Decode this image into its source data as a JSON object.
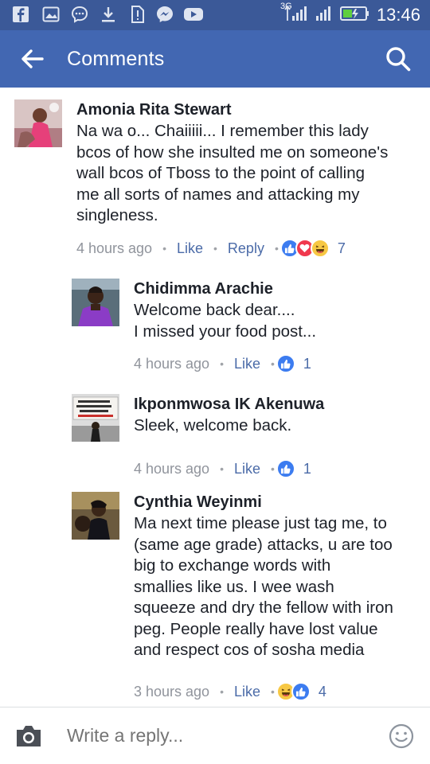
{
  "status_bar": {
    "network": "3G",
    "time": "13:46",
    "icons": [
      "facebook-icon",
      "gallery-icon",
      "chat-icon",
      "download-icon",
      "alert-icon",
      "messenger-icon",
      "youtube-icon",
      "signal-icon",
      "battery-icon"
    ]
  },
  "app_bar": {
    "title": "Comments",
    "back_icon": "arrow-left-icon",
    "search_icon": "search-icon"
  },
  "colors": {
    "status_bar": "#3b5998",
    "app_bar": "#4267b2",
    "link": "#4b6ba8",
    "like_blue": "#3c7cf0",
    "love_red": "#f0394e",
    "haha_yellow": "#f7c844"
  },
  "comments": [
    {
      "author": "Amonia Rita Stewart",
      "lines": [
        "Na wa o... Chaiiiii... I remember this lady",
        "bcos of how she insulted me on someone's",
        "wall bcos of Tboss to the point of calling",
        "me all sorts of names and attacking my",
        "singleness."
      ],
      "time": "4 hours ago",
      "like_label": "Like",
      "reply_label": "Reply",
      "reactions": [
        "like",
        "love",
        "haha"
      ],
      "reaction_count": "7"
    },
    {
      "author": "Chidimma Arachie",
      "lines": [
        "Welcome back dear....",
        "I missed your food post..."
      ],
      "time": "4 hours ago",
      "like_label": "Like",
      "reactions": [
        "like"
      ],
      "reaction_count": "1"
    },
    {
      "author": "Ikponmwosa IK Akenuwa",
      "lines": [
        "Sleek, welcome back."
      ],
      "time": "4 hours ago",
      "like_label": "Like",
      "reactions": [
        "like"
      ],
      "reaction_count": "1"
    },
    {
      "author": "Cynthia Weyinmi",
      "lines": [
        "Ma next time please just tag me, to",
        "(same age grade) attacks, u are too",
        "big to exchange words with",
        "smallies like us. I wee wash",
        "squeeze and dry the fellow with iron",
        "peg. People really have lost value",
        "and respect cos of sosha media"
      ],
      "time": "3 hours ago",
      "like_label": "Like",
      "reactions": [
        "haha",
        "like"
      ],
      "reaction_count": "4"
    }
  ],
  "reply_bar": {
    "placeholder": "Write a reply...",
    "camera_icon": "camera-icon",
    "emoji_icon": "emoji-icon"
  }
}
